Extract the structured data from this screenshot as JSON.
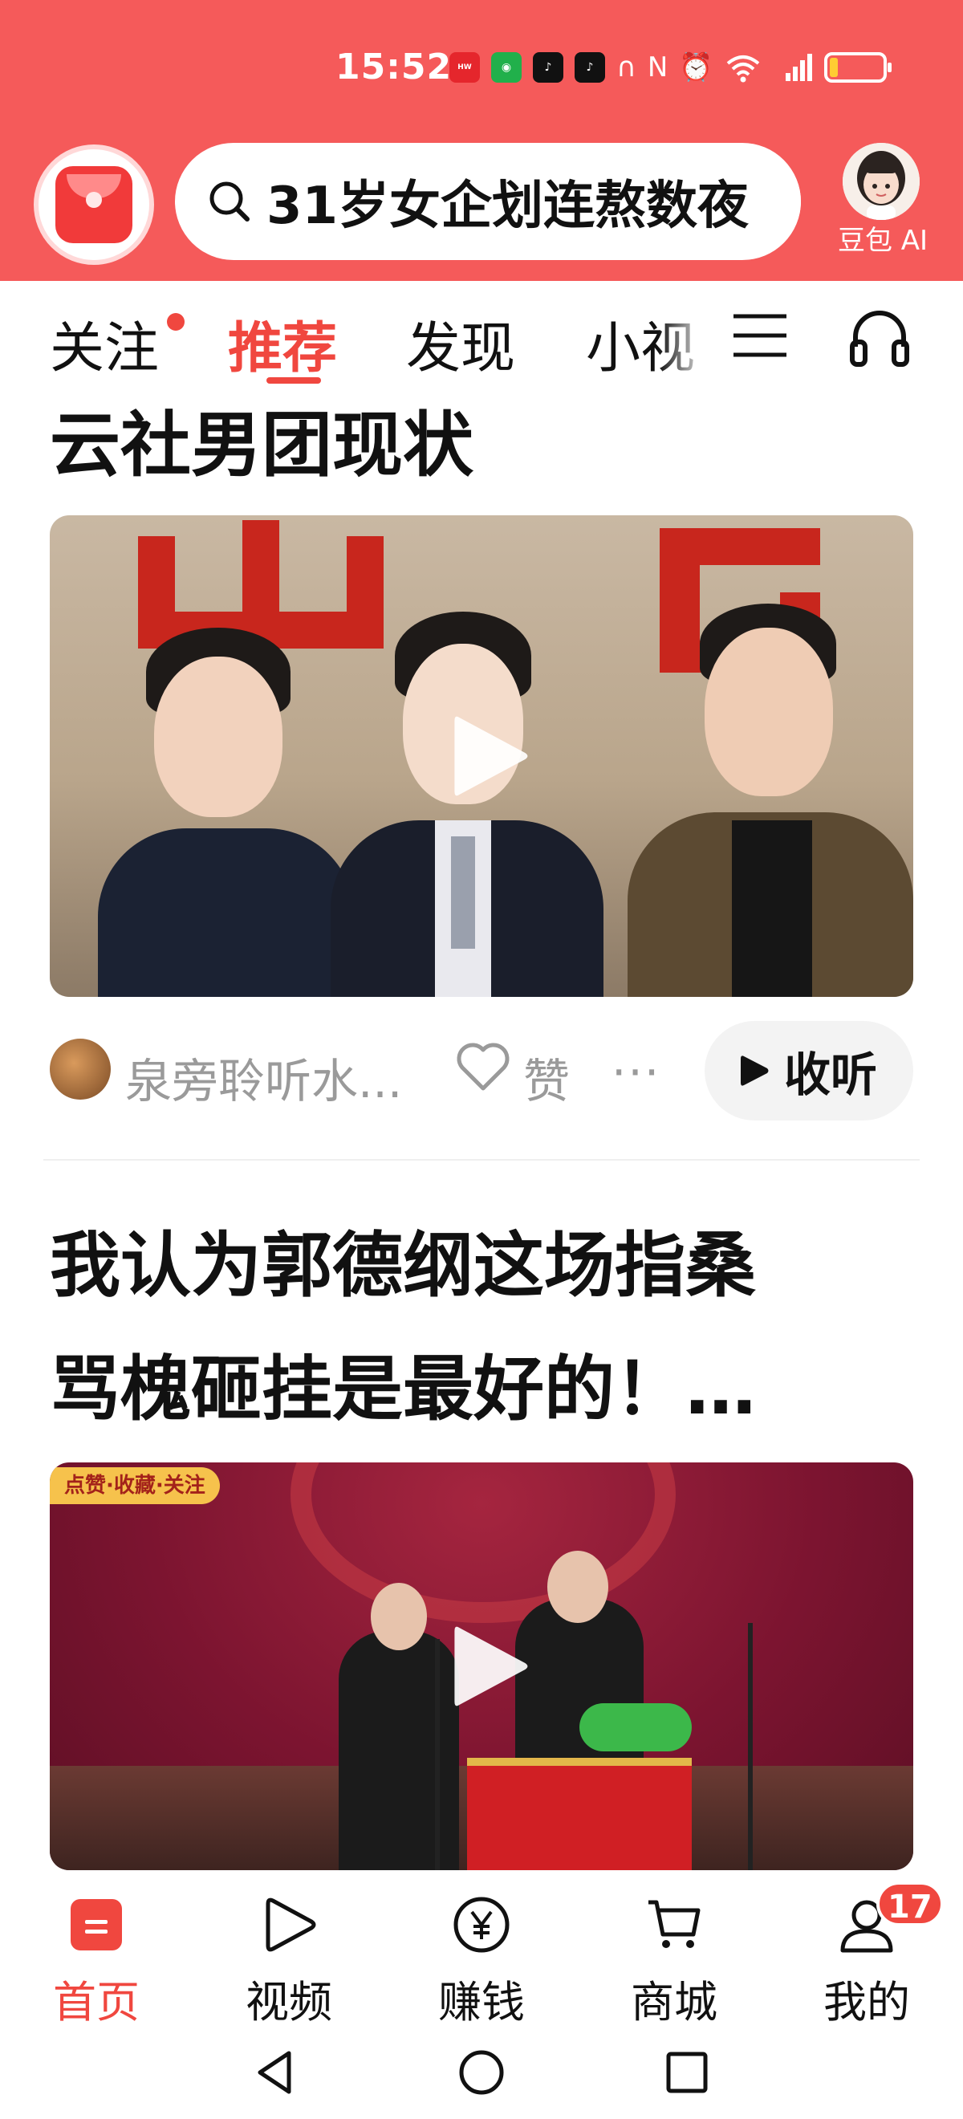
{
  "status_bar": {
    "time": "15:52",
    "icons": [
      "huawei-app-icon",
      "wechat-icon",
      "tiktok-icon",
      "tiktok-lite-icon",
      "headphone-icon",
      "nfc-icon",
      "alarm-icon",
      "wifi-6-icon",
      "5g-signal-icon",
      "battery-low-icon"
    ]
  },
  "header": {
    "search_query": "31岁女企划连熬数夜",
    "ai_label": "豆包 AI"
  },
  "tabs": [
    {
      "label": "关注",
      "has_dot": true
    },
    {
      "label": "推荐",
      "active": true
    },
    {
      "label": "发现"
    },
    {
      "label": "小视"
    }
  ],
  "feed": [
    {
      "title": "云社男团现状",
      "author": "泉旁聆听水...",
      "like_label": "赞",
      "more": "···",
      "listen_label": "收听"
    },
    {
      "title_line1": "我认为郭德纲这场指桑",
      "title_line2": "骂槐砸挂是最好的！…",
      "thumb_tag": "点赞·收藏·关注"
    }
  ],
  "bottom_nav": [
    {
      "label": "首页",
      "icon": "home-icon",
      "active": true
    },
    {
      "label": "视频",
      "icon": "play-icon"
    },
    {
      "label": "赚钱",
      "icon": "yuan-coin-icon"
    },
    {
      "label": "商城",
      "icon": "cart-icon"
    },
    {
      "label": "我的",
      "icon": "user-icon",
      "badge": "17"
    }
  ],
  "colors": {
    "brand_red": "#f55a5a",
    "accent": "#f0473f",
    "muted_text": "#9a9a9a"
  }
}
